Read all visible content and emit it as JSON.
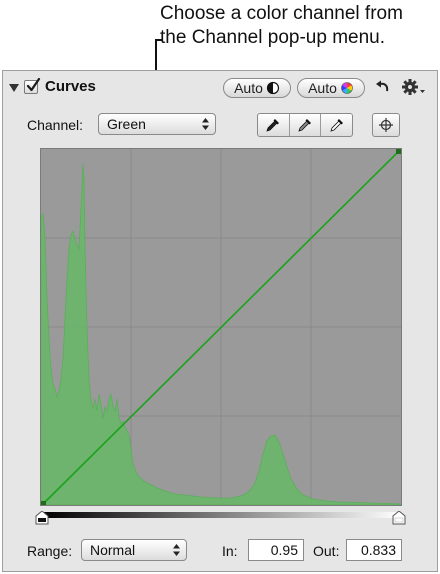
{
  "callout": {
    "line1": "Choose a color channel from",
    "line2": "the Channel pop-up menu."
  },
  "panel": {
    "title": "Curves",
    "enabled": true,
    "auto_bw_label": "Auto",
    "auto_color_label": "Auto",
    "icons": {
      "disclosure": "disclosure-triangle-icon",
      "undo": "undo-arrow-icon",
      "gear": "gear-menu-icon",
      "eyedroppers": [
        "black-point-eyedropper-icon",
        "gray-point-eyedropper-icon",
        "white-point-eyedropper-icon"
      ],
      "target": "crosshair-target-icon"
    }
  },
  "channel": {
    "label": "Channel:",
    "selected": "Green"
  },
  "curve": {
    "channel_color": "#1aa31a",
    "histogram_fill": "#66b866"
  },
  "range": {
    "label": "Range:",
    "selected": "Normal"
  },
  "in": {
    "label": "In:",
    "value": "0.95"
  },
  "out": {
    "label": "Out:",
    "value": "0.833"
  }
}
